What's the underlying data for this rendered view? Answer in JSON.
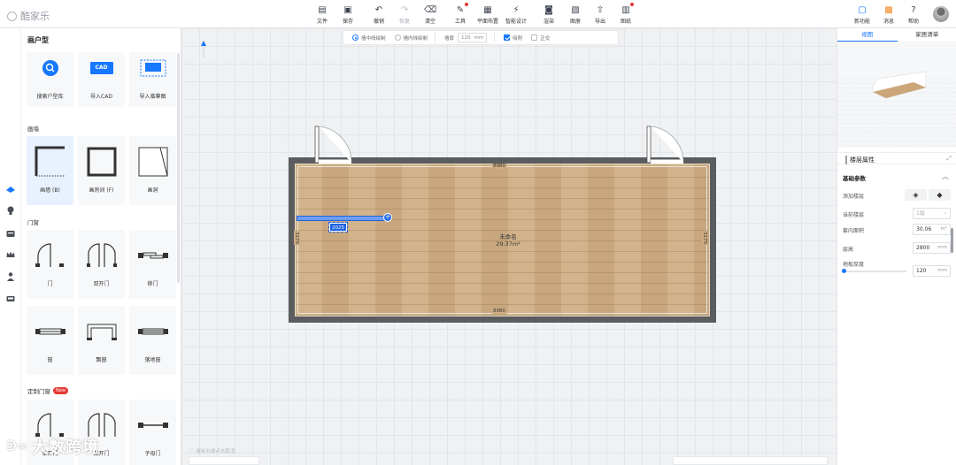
{
  "app": {
    "logo_text": "酷家乐"
  },
  "toolbar": {
    "items": [
      {
        "label": "文件",
        "icon": "file-icon"
      },
      {
        "label": "保存",
        "icon": "save-icon"
      },
      {
        "label": "撤销",
        "icon": "undo-icon"
      },
      {
        "label": "恢复",
        "icon": "redo-icon"
      },
      {
        "label": "清空",
        "icon": "clear-icon"
      },
      {
        "label": "工具",
        "icon": "wrench-icon"
      },
      {
        "label": "平面布置",
        "icon": "layout-icon"
      },
      {
        "label": "智能设计",
        "icon": "smart-design-icon"
      },
      {
        "label": "渲染",
        "icon": "camera-icon"
      },
      {
        "label": "图册",
        "icon": "album-icon"
      },
      {
        "label": "导出",
        "icon": "export-icon"
      },
      {
        "label": "图纸",
        "icon": "drawing-icon"
      }
    ],
    "right_items": [
      {
        "label": "新功能",
        "icon": "new-feature-icon"
      },
      {
        "label": "消息",
        "icon": "gift-icon"
      },
      {
        "label": "帮助",
        "icon": "help-icon"
      }
    ]
  },
  "library": {
    "title": "画户型",
    "top_cards": [
      {
        "label": "搜索户型库",
        "icon": "search-floorplan-icon"
      },
      {
        "label": "导入CAD",
        "icon": "cad-icon",
        "icon_text": "CAD"
      },
      {
        "label": "导入临摹图",
        "icon": "trace-image-icon"
      }
    ],
    "sections": [
      {
        "title": "画墙",
        "items": [
          {
            "label": "画墙 (B)",
            "icon": "draw-wall-icon"
          },
          {
            "label": "画房间 (F)",
            "icon": "draw-room-icon"
          },
          {
            "label": "画洞",
            "icon": "draw-hole-icon"
          }
        ]
      },
      {
        "title": "门窗",
        "items": [
          {
            "label": "门",
            "icon": "door-icon"
          },
          {
            "label": "双开门",
            "icon": "double-door-icon"
          },
          {
            "label": "移门",
            "icon": "sliding-door-icon"
          },
          {
            "label": "窗",
            "icon": "window-icon"
          },
          {
            "label": "飘窗",
            "icon": "bay-window-icon"
          },
          {
            "label": "落地窗",
            "icon": "floor-window-icon"
          }
        ]
      },
      {
        "title": "定制门窗",
        "badge": "New",
        "items": [
          {
            "label": "单开门",
            "icon": "custom-single-door-icon"
          },
          {
            "label": "双开门",
            "icon": "custom-double-door-icon"
          },
          {
            "label": "子母门",
            "icon": "mother-door-icon"
          }
        ]
      }
    ]
  },
  "canvas": {
    "mode_bar": {
      "radio1": "墙中线绘制",
      "radio2": "墙内线绘制",
      "thickness_label": "墙厚",
      "thickness_value": "120",
      "thickness_unit": "mm",
      "check1": "吸附",
      "check2": "正交"
    },
    "room": {
      "name": "未命名",
      "area": "29.37m²",
      "dim_top": "8980",
      "dim_bottom": "8980",
      "dim_left": "3270",
      "dim_right": "3270",
      "selected_wall_dim": "2025",
      "handle_symbol": "+"
    },
    "hint": "鼠标右键点击取消"
  },
  "right_panel": {
    "tabs": [
      "视图",
      "家居清单"
    ],
    "active_tab": 0,
    "props_title": "楼层属性",
    "basic_title": "基础参数",
    "rows": [
      {
        "label": "添加楼层"
      },
      {
        "label": "当前楼层",
        "value": "1层"
      },
      {
        "label": "套内面积",
        "value": "30.06",
        "unit": "m²"
      },
      {
        "label": "层高",
        "value": "2800",
        "unit": "mm"
      },
      {
        "label": "地板厚度",
        "value": "120",
        "unit": "mm"
      }
    ]
  },
  "watermark": {
    "text": "大数跨境"
  },
  "colors": {
    "accent": "#1677ff",
    "wall": "#5b5c5e",
    "floor": "#cfae84",
    "badge": "#e53935"
  }
}
